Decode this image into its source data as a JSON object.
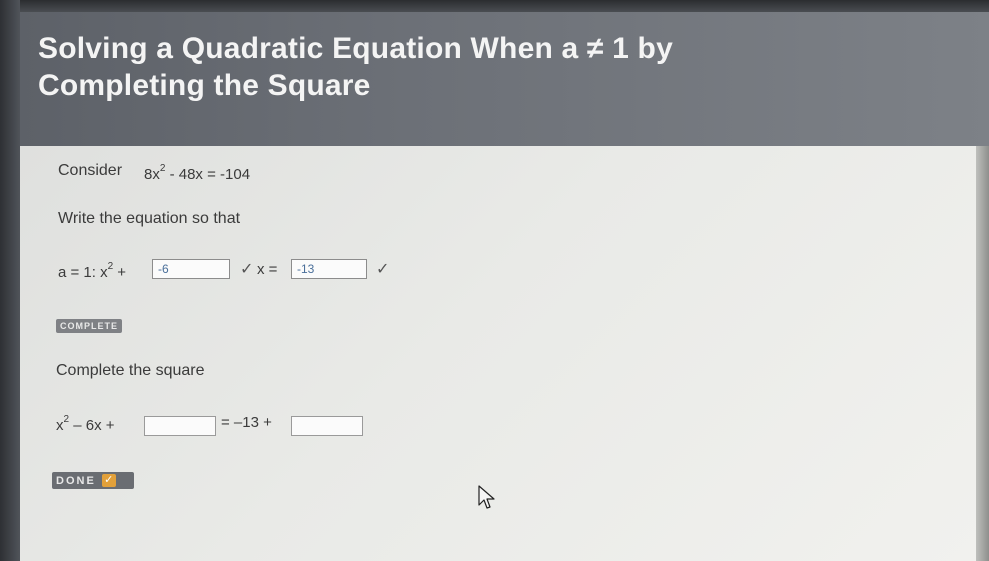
{
  "header": {
    "title_line1": "Solving a Quadratic Equation When a ≠ 1 by",
    "title_line2": "Completing the Square"
  },
  "step1": {
    "consider_label": "Consider",
    "equation_part1": "8x",
    "equation_exp": "2",
    "equation_part2": " - 48x = -104"
  },
  "step2": {
    "instruction": "Write the equation so that",
    "prefix": "a = 1: x",
    "prefix_exp": "2",
    "plus": "+",
    "b_value": "-6",
    "x_label": "x =",
    "x_value": "-13",
    "check_icon": "✓"
  },
  "badge": {
    "label": "COMPLETE"
  },
  "step3": {
    "instruction": "Complete the square",
    "left_part1": "x",
    "left_exp": "2",
    "left_part2": " – 6x +",
    "middle": "= –13 +",
    "input1_value": "",
    "input2_value": ""
  },
  "done_button": {
    "label": "DONE",
    "icon": "✓",
    "accent": "#e3a13a"
  }
}
